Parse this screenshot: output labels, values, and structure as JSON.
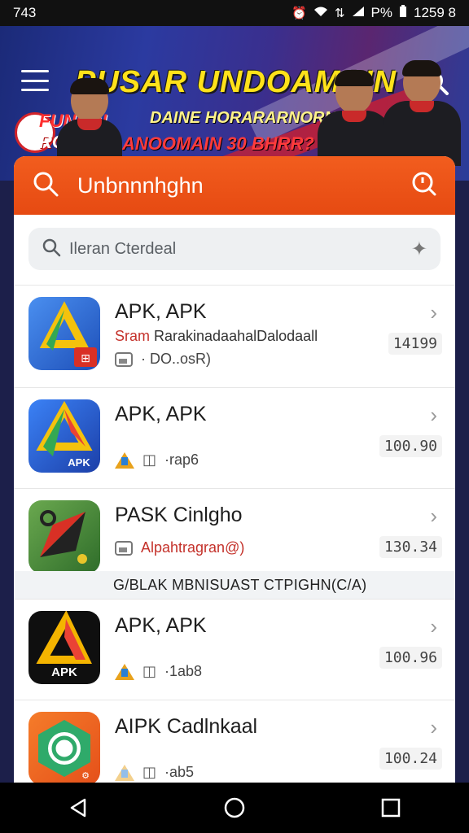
{
  "status": {
    "time": "743",
    "battery_percent": "P%",
    "clock_right": "1259 8",
    "icons": [
      "alarm-icon",
      "wifi-icon",
      "data-icon",
      "signal-icon",
      "battery-icon"
    ]
  },
  "banner": {
    "title": "PUSAR UNDOAMAIN",
    "subtitle_line1": "DAINE HORARARNORNSI9",
    "subtitle_line2": "ANOOMAIN 30 BHRR?",
    "logo_line1": "FUNIAN",
    "logo_line2": "ROMSA"
  },
  "header": {
    "title": "Unbnnnhghn",
    "left_icon": "search-icon",
    "right_icon": "clock-icon",
    "accent": "#f05a1e"
  },
  "search": {
    "placeholder": "Ileran Cterdeal"
  },
  "apps": [
    {
      "name": "APK, APK",
      "line1_prefix": "Sram ",
      "line1_rest": "RarakinadaahalDalodaall",
      "meta": "· DO..osR)",
      "price": "14199",
      "icon": "drive-icon"
    },
    {
      "name": "APK, APK",
      "meta": "·rap6",
      "price": "100.90",
      "icon": "drive-apk-icon"
    },
    {
      "name": "PASK Cinlgho",
      "line1_red": "Alpahtragran@)",
      "price": "130.34",
      "icon": "compass-icon"
    },
    {
      "name": "APK, APK",
      "meta": "·1ab8",
      "price": "100.96",
      "icon": "apk-black-icon"
    },
    {
      "name": "AIPK Cadlnkaal",
      "meta": "·ab5",
      "price": "100.24",
      "icon": "chat-icon"
    }
  ],
  "section": {
    "label": "G/BLAK MBNISUAST CTPIGHN(C/A)"
  },
  "colors": {
    "header_orange": "#f05a1e",
    "banner_blue": "#2b3aa0",
    "title_yellow": "#ffe21a"
  }
}
